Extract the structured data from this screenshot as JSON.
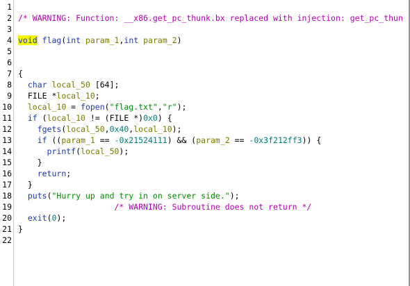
{
  "lines": [
    {
      "n": "1",
      "segs": []
    },
    {
      "n": "2",
      "segs": [
        {
          "c": "comment",
          "t": "/* WARNING: Function: __x86.get_pc_thunk.bx replaced with injection: get_pc_thun"
        }
      ]
    },
    {
      "n": "3",
      "segs": []
    },
    {
      "n": "4",
      "segs": [
        {
          "c": "kw-void",
          "t": "void"
        },
        {
          "c": "plain",
          "t": " "
        },
        {
          "c": "fn",
          "t": "flag"
        },
        {
          "c": "plain",
          "t": "("
        },
        {
          "c": "type",
          "t": "int"
        },
        {
          "c": "plain",
          "t": " "
        },
        {
          "c": "var",
          "t": "param_1"
        },
        {
          "c": "plain",
          "t": ","
        },
        {
          "c": "type",
          "t": "int"
        },
        {
          "c": "plain",
          "t": " "
        },
        {
          "c": "var",
          "t": "param_2"
        },
        {
          "c": "plain",
          "t": ")"
        }
      ]
    },
    {
      "n": "5",
      "segs": []
    },
    {
      "n": "6",
      "segs": []
    },
    {
      "n": "7",
      "segs": [
        {
          "c": "plain",
          "t": "{"
        }
      ]
    },
    {
      "n": "8",
      "segs": [
        {
          "c": "plain",
          "t": "  "
        },
        {
          "c": "type",
          "t": "char"
        },
        {
          "c": "plain",
          "t": " "
        },
        {
          "c": "var",
          "t": "local_50"
        },
        {
          "c": "plain",
          "t": " [64];"
        }
      ]
    },
    {
      "n": "9",
      "segs": [
        {
          "c": "plain",
          "t": "  FILE *"
        },
        {
          "c": "var",
          "t": "local_10"
        },
        {
          "c": "plain",
          "t": ";"
        }
      ]
    },
    {
      "n": "10",
      "segs": []
    },
    {
      "n": "10",
      "segs": [
        {
          "c": "plain",
          "t": "  "
        },
        {
          "c": "var",
          "t": "local_10"
        },
        {
          "c": "plain",
          "t": " = "
        },
        {
          "c": "fn",
          "t": "fopen"
        },
        {
          "c": "plain",
          "t": "("
        },
        {
          "c": "str",
          "t": "\"flag.txt\""
        },
        {
          "c": "plain",
          "t": ","
        },
        {
          "c": "str",
          "t": "\"r\""
        },
        {
          "c": "plain",
          "t": ");"
        }
      ]
    },
    {
      "n": "11",
      "segs": [
        {
          "c": "plain",
          "t": "  "
        },
        {
          "c": "kw",
          "t": "if"
        },
        {
          "c": "plain",
          "t": " ("
        },
        {
          "c": "var",
          "t": "local_10"
        },
        {
          "c": "plain",
          "t": " != (FILE *)"
        },
        {
          "c": "num",
          "t": "0x0"
        },
        {
          "c": "plain",
          "t": ") {"
        }
      ]
    },
    {
      "n": "12",
      "segs": [
        {
          "c": "plain",
          "t": "    "
        },
        {
          "c": "fn",
          "t": "fgets"
        },
        {
          "c": "plain",
          "t": "("
        },
        {
          "c": "var",
          "t": "local_50"
        },
        {
          "c": "plain",
          "t": ","
        },
        {
          "c": "num",
          "t": "0x40"
        },
        {
          "c": "plain",
          "t": ","
        },
        {
          "c": "var",
          "t": "local_10"
        },
        {
          "c": "plain",
          "t": ");"
        }
      ]
    },
    {
      "n": "13",
      "segs": [
        {
          "c": "plain",
          "t": "    "
        },
        {
          "c": "kw",
          "t": "if"
        },
        {
          "c": "plain",
          "t": " (("
        },
        {
          "c": "var",
          "t": "param_1"
        },
        {
          "c": "plain",
          "t": " == "
        },
        {
          "c": "num",
          "t": "-0x21524111"
        },
        {
          "c": "plain",
          "t": ") && ("
        },
        {
          "c": "var",
          "t": "param_2"
        },
        {
          "c": "plain",
          "t": " == "
        },
        {
          "c": "num",
          "t": "-0x3f212ff3"
        },
        {
          "c": "plain",
          "t": ")) {"
        }
      ]
    },
    {
      "n": "14",
      "segs": [
        {
          "c": "plain",
          "t": "      "
        },
        {
          "c": "fn",
          "t": "printf"
        },
        {
          "c": "plain",
          "t": "("
        },
        {
          "c": "var",
          "t": "local_50"
        },
        {
          "c": "plain",
          "t": ");"
        }
      ]
    },
    {
      "n": "15",
      "segs": [
        {
          "c": "plain",
          "t": "    }"
        }
      ]
    },
    {
      "n": "16",
      "segs": [
        {
          "c": "plain",
          "t": "    "
        },
        {
          "c": "kw",
          "t": "return"
        },
        {
          "c": "plain",
          "t": ";"
        }
      ]
    },
    {
      "n": "17",
      "segs": [
        {
          "c": "plain",
          "t": "  }"
        }
      ]
    },
    {
      "n": "18",
      "segs": [
        {
          "c": "plain",
          "t": "  "
        },
        {
          "c": "fn",
          "t": "puts"
        },
        {
          "c": "plain",
          "t": "("
        },
        {
          "c": "str",
          "t": "\"Hurry up and try in on server side.\""
        },
        {
          "c": "plain",
          "t": ");"
        }
      ]
    },
    {
      "n": "19",
      "segs": [
        {
          "c": "plain",
          "t": "                    "
        },
        {
          "c": "comment",
          "t": "/* WARNING: Subroutine does not return */"
        }
      ]
    },
    {
      "n": "20",
      "segs": [
        {
          "c": "plain",
          "t": "  "
        },
        {
          "c": "fn",
          "t": "exit"
        },
        {
          "c": "plain",
          "t": "("
        },
        {
          "c": "num",
          "t": "0"
        },
        {
          "c": "plain",
          "t": ");"
        }
      ]
    },
    {
      "n": "21",
      "segs": [
        {
          "c": "plain",
          "t": "}"
        }
      ]
    },
    {
      "n": "22",
      "segs": []
    }
  ]
}
